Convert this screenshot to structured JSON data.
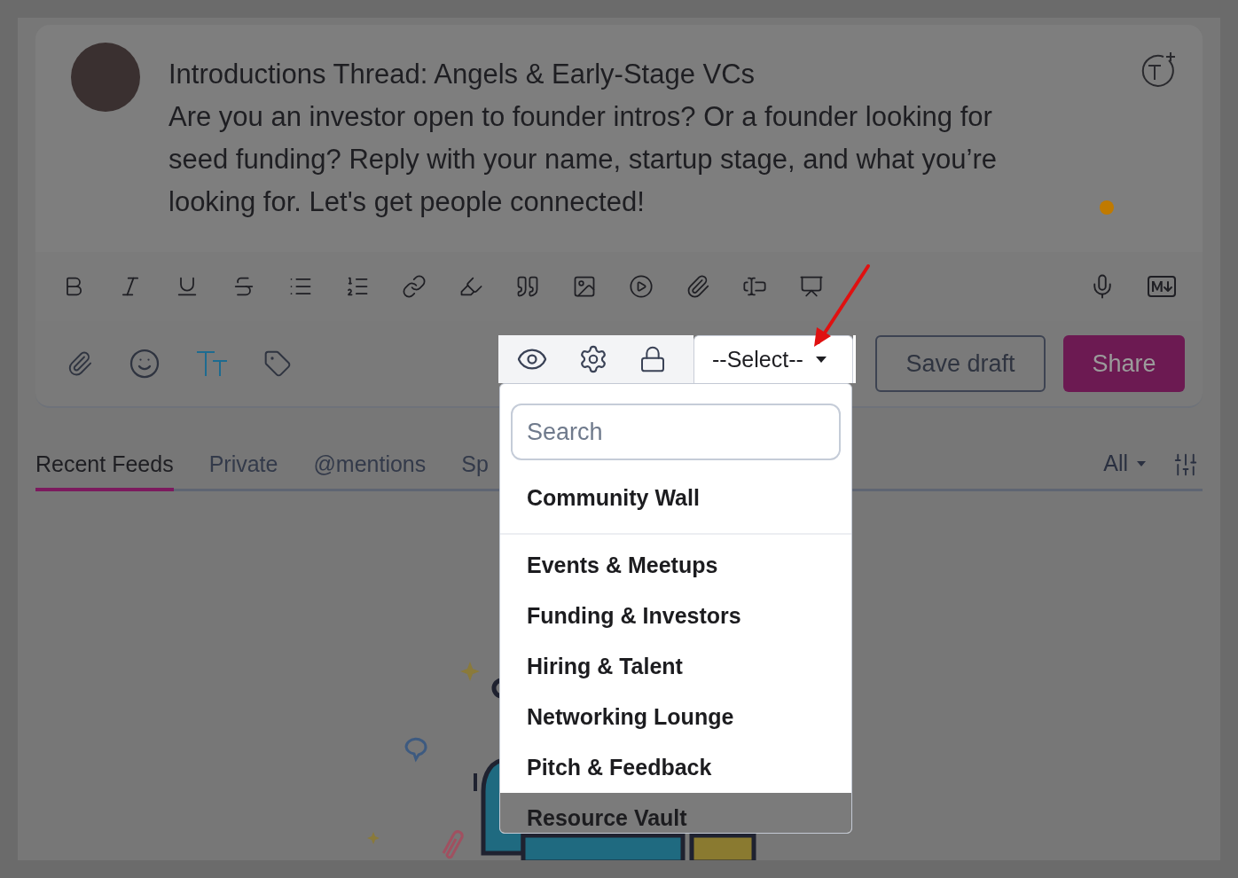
{
  "post": {
    "title": "Introductions Thread: Angels & Early-Stage VCs",
    "body": "Are you an investor open to founder intros? Or a founder looking for seed funding? Reply with your name, startup stage, and what you’re looking for. Let's get people connected!"
  },
  "audience_select": {
    "value": "--Select--",
    "expanded": true,
    "search": {
      "placeholder": "Search"
    },
    "options": [
      {
        "label": "Community Wall",
        "kind": "pinned",
        "highlighted": true
      },
      {
        "label": "Events & Meetups",
        "kind": "group",
        "highlighted": true
      },
      {
        "label": "Funding & Investors",
        "kind": "group",
        "highlighted": true
      },
      {
        "label": "Hiring & Talent",
        "kind": "group",
        "highlighted": true
      },
      {
        "label": "Networking Lounge",
        "kind": "group",
        "highlighted": true
      },
      {
        "label": "Pitch & Feedback",
        "kind": "group",
        "highlighted": true
      },
      {
        "label": "Resource Vault",
        "kind": "group",
        "highlighted": false
      }
    ]
  },
  "buttons": {
    "save_draft": "Save draft",
    "share": "Share"
  },
  "tabs": [
    {
      "label": "Recent Feeds",
      "selected": true
    },
    {
      "label": "Private",
      "selected": false
    },
    {
      "label": "@mentions",
      "selected": false
    },
    {
      "label": "Sp",
      "selected": false
    }
  ],
  "feed_filter": {
    "label": "All"
  }
}
